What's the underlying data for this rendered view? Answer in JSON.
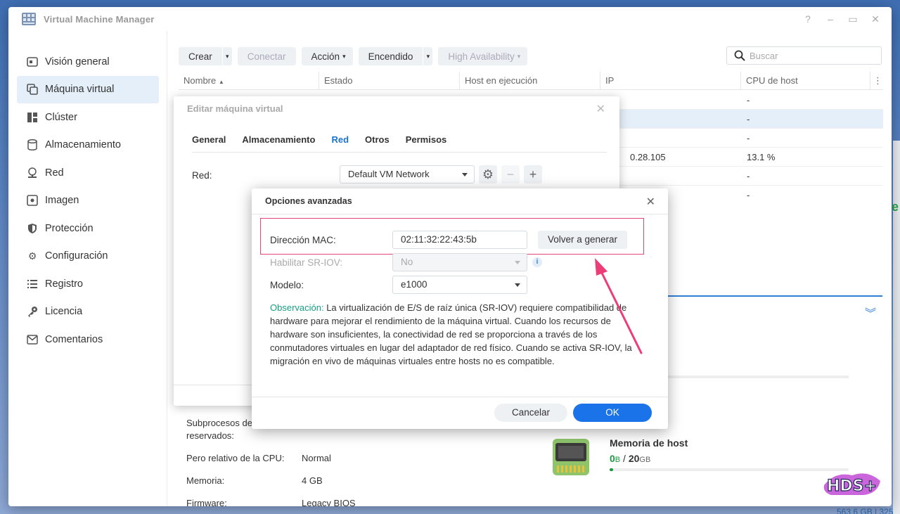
{
  "window": {
    "title": "Virtual Machine Manager"
  },
  "sidebar": {
    "items": [
      {
        "label": "Visión general",
        "icon": "overview-icon"
      },
      {
        "label": "Máquina virtual",
        "icon": "vm-icon"
      },
      {
        "label": "Clúster",
        "icon": "cluster-icon"
      },
      {
        "label": "Almacenamiento",
        "icon": "storage-icon"
      },
      {
        "label": "Red",
        "icon": "network-icon"
      },
      {
        "label": "Imagen",
        "icon": "image-icon"
      },
      {
        "label": "Protección",
        "icon": "shield-icon"
      },
      {
        "label": "Configuración",
        "icon": "gear-icon"
      },
      {
        "label": "Registro",
        "icon": "log-icon"
      },
      {
        "label": "Licencia",
        "icon": "key-icon"
      },
      {
        "label": "Comentarios",
        "icon": "mail-icon"
      }
    ]
  },
  "toolbar": {
    "create": "Crear",
    "connect": "Conectar",
    "action": "Acción",
    "power": "Encendido",
    "ha": "High Availability"
  },
  "search": {
    "placeholder": "Buscar"
  },
  "grid": {
    "columns": [
      "Nombre",
      "Estado",
      "Host en ejecución",
      "IP",
      "CPU de host"
    ],
    "rows": [
      {
        "ip": "",
        "cpu": "-"
      },
      {
        "ip": "",
        "cpu": "-"
      },
      {
        "ip": "",
        "cpu": "-"
      },
      {
        "ip": "0.28.105",
        "cpu": "13.1 %"
      },
      {
        "ip": "",
        "cpu": "-"
      },
      {
        "ip": "",
        "cpu": "-"
      }
    ]
  },
  "details": {
    "threads_label_1": "Subprocesos de",
    "threads_label_2": "reservados:",
    "cpu_weight_label": "Pero relativo de la CPU:",
    "cpu_weight_value": "Normal",
    "memory_label": "Memoria:",
    "memory_value": "4 GB",
    "firmware_label": "Firmware:",
    "firmware_value": "Legacy BIOS"
  },
  "host_memory": {
    "title": "Memoria de host",
    "used_num": "0",
    "used_unit": "B",
    "sep": " / ",
    "total_num": "20",
    "total_unit": "GB",
    "used_fraction": 0.0
  },
  "desktop": {
    "bottom_text": "563.6 GB | 325"
  },
  "edit_dialog": {
    "title": "Editar máquina virtual",
    "tabs": [
      "General",
      "Almacenamiento",
      "Red",
      "Otros",
      "Permisos"
    ],
    "active_tab": "Red",
    "network_label": "Red:",
    "network_value": "Default VM Network"
  },
  "adv_dialog": {
    "title": "Opciones avanzadas",
    "mac_label": "Dirección MAC:",
    "mac_value": "02:11:32:22:43:5b",
    "regen_label": "Volver a generar",
    "sriov_label": "Habilitar SR-IOV:",
    "sriov_value": "No",
    "model_label": "Modelo:",
    "model_value": "e1000",
    "note_key": "Observación:",
    "note_text": " La virtualización de E/S de raíz única (SR-IOV) requiere compatibilidad de hardware para mejorar el rendimiento de la máquina virtual. Cuando los recursos de hardware son insuficientes, la conectividad de red se proporciona a través de los conmutadores virtuales en lugar del adaptador de red físico. Cuando se activa SR-IOV, la migración en vivo de máquinas virtuales entre hosts no es compatible.",
    "cancel": "Cancelar",
    "ok": "OK"
  },
  "colors": {
    "accent": "#1a73e8",
    "highlight": "#e2457a",
    "note_key": "#16a085",
    "green": "#1a9a3e"
  },
  "watermark": {
    "text": "HDS+"
  }
}
